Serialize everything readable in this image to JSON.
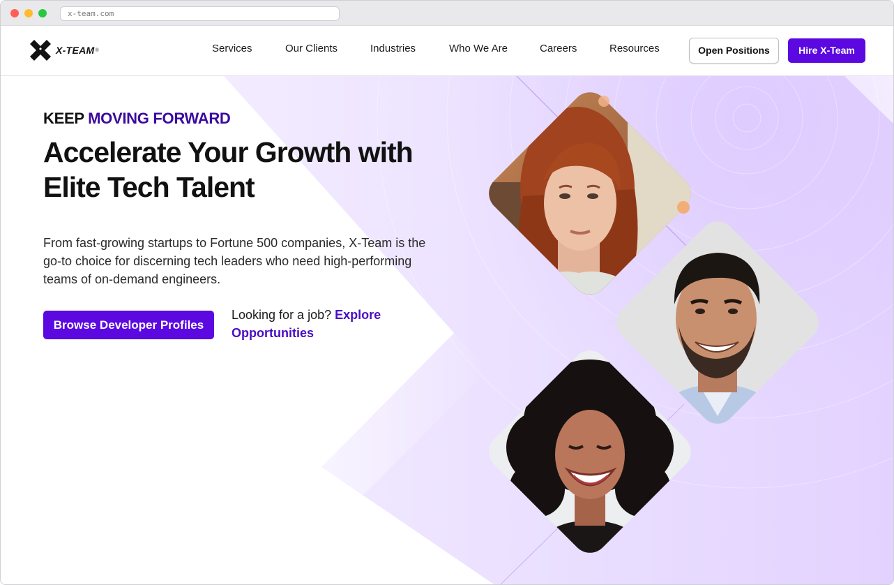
{
  "browser": {
    "url": "x-team.com"
  },
  "header": {
    "logo_text": "X-TEAM",
    "logo_reg": "®",
    "nav": [
      {
        "label": "Services"
      },
      {
        "label": "Our Clients"
      },
      {
        "label": "Industries"
      },
      {
        "label": "Who We Are"
      },
      {
        "label": "Careers"
      },
      {
        "label": "Resources"
      }
    ],
    "open_positions_label": "Open Positions",
    "hire_label": "Hire X-Team"
  },
  "hero": {
    "eyebrow_lead": "KEEP ",
    "eyebrow_accent": "MOVING FORWARD",
    "headline": "Accelerate Your Growth with Elite Tech Talent",
    "lede": "From fast-growing startups to Fortune 500 companies, X-Team is the go-to choice for discerning tech leaders who need high-performing teams of on-demand engineers.",
    "cta_label": "Browse Developer Profiles",
    "job_prompt": "Looking for a job? ",
    "job_link": "Explore Opportunities"
  },
  "colors": {
    "brand_purple": "#5b09e0",
    "accent_text": "#3b0a9e",
    "hero_lavender": "#e9dcff"
  },
  "portraits": [
    {
      "name": "woman-red-hair-photo"
    },
    {
      "name": "smiling-man-photo"
    },
    {
      "name": "laughing-woman-curly-hair-photo"
    }
  ]
}
